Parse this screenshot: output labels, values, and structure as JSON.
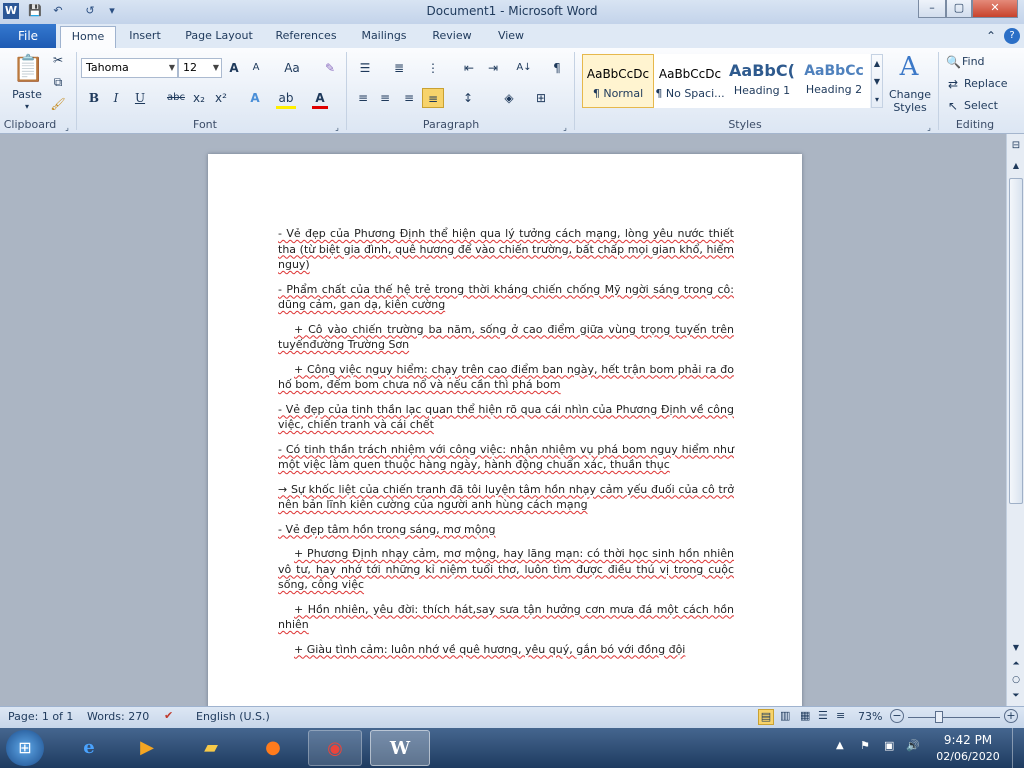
{
  "window": {
    "title": "Document1  -  Microsoft Word",
    "minimize": "–",
    "maximize": "▢",
    "close": "✕"
  },
  "quick_access": {
    "word_icon": "W",
    "save": "💾",
    "undo": "↶",
    "redo": "↺",
    "more": "▾"
  },
  "tabs": [
    {
      "label": "File"
    },
    {
      "label": "Home"
    },
    {
      "label": "Insert"
    },
    {
      "label": "Page Layout"
    },
    {
      "label": "References"
    },
    {
      "label": "Mailings"
    },
    {
      "label": "Review"
    },
    {
      "label": "View"
    }
  ],
  "ribbon": {
    "clipboard": {
      "label": "Clipboard",
      "paste": "Paste"
    },
    "font": {
      "label": "Font",
      "name": "Tahoma",
      "size": "12",
      "grow": "A",
      "shrink": "A",
      "case": "Aa",
      "clear": "✎",
      "bold": "B",
      "italic": "I",
      "underline": "U",
      "strike": "abc",
      "sub": "x₂",
      "sup": "x²",
      "effects": "A",
      "highlight": "ab",
      "color": "A"
    },
    "paragraph": {
      "label": "Paragraph",
      "sort": "A↓",
      "pilcrow": "¶"
    },
    "styles": {
      "label": "Styles",
      "items": [
        {
          "sample": "AaBbCcDc",
          "name": "¶ Normal"
        },
        {
          "sample": "AaBbCcDc",
          "name": "¶ No Spaci..."
        },
        {
          "sample": "AaBbC(",
          "name": "Heading 1"
        },
        {
          "sample": "AaBbCc",
          "name": "Heading 2"
        }
      ],
      "change": "Change",
      "change2": "Styles"
    },
    "editing": {
      "label": "Editing",
      "find": "Find",
      "replace": "Replace",
      "select": "Select"
    }
  },
  "document": {
    "paragraphs": [
      {
        "text": "- Vẻ đẹp của Phương Định thể hiện qua lý tưởng cách mạng, lòng yêu nước thiết tha (từ biệt gia đình, quê hương để vào chiến trường, bất chấp mọi gian khổ, hiểm nguy)",
        "indent": false
      },
      {
        "text": "- Phẩm chất của thế hệ trẻ trong thời kháng chiến chống Mỹ ngời sáng trong cô: dũng cảm, gan dạ, kiên cường",
        "indent": false
      },
      {
        "text": "+ Cô vào chiến trường ba năm, sống ở cao điểm giữa vùng trọng tuyến trên tuyếnđường Trường Sơn",
        "indent": true
      },
      {
        "text": "+ Công việc nguy hiểm: chạy trên cao điểm ban ngày, hết trận bom phải ra đo hố bom, đếm bom chưa nổ và nếu cần thì phá bom",
        "indent": true
      },
      {
        "text": "- Vẻ đẹp của tinh thần lạc quan thể hiện rõ qua cái nhìn của Phương Định về công việc, chiến tranh và cái chết",
        "indent": false
      },
      {
        "text": "- Có tinh thần trách nhiệm với công việc: nhận nhiệm vụ phá bom nguy hiểm như một việc làm quen thuộc hàng ngày, hành động chuẩn xác, thuần thục",
        "indent": false
      },
      {
        "text": "→ Sự khốc liệt của chiến tranh đã tôi luyện tâm hồn nhạy cảm yếu đuối của cô trở nên bản lĩnh kiên cường của người anh hùng cách mạng",
        "indent": false
      },
      {
        "text": "- Vẻ đẹp tâm hồn trong sáng, mơ mộng",
        "indent": false
      },
      {
        "text": "+ Phương Định nhạy cảm, mơ mộng, hay lãng mạn: có thời học sinh hồn nhiên vô tư, hay nhớ tới những kỉ niệm tuổi thơ, luôn tìm được điều thú vị trong cuộc sống, công việc",
        "indent": true
      },
      {
        "text": "+ Hồn nhiên, yêu đời: thích hát,say sưa tận hưởng cơn mưa đá một cách hồn nhiên",
        "indent": true
      },
      {
        "text": "+ Giàu tình cảm: luôn nhớ về quê hương, yêu quý, gắn bó với đồng đội",
        "indent": true
      }
    ]
  },
  "status": {
    "page": "Page: 1 of 1",
    "words": "Words: 270",
    "language": "English (U.S.)",
    "zoom": "73%",
    "minus": "−",
    "plus": "+"
  },
  "taskbar": {
    "time": "9:42 PM",
    "date": "02/06/2020"
  },
  "colors": {
    "accent": "#2b579a",
    "ribbon_bg": "#dce6f3"
  }
}
